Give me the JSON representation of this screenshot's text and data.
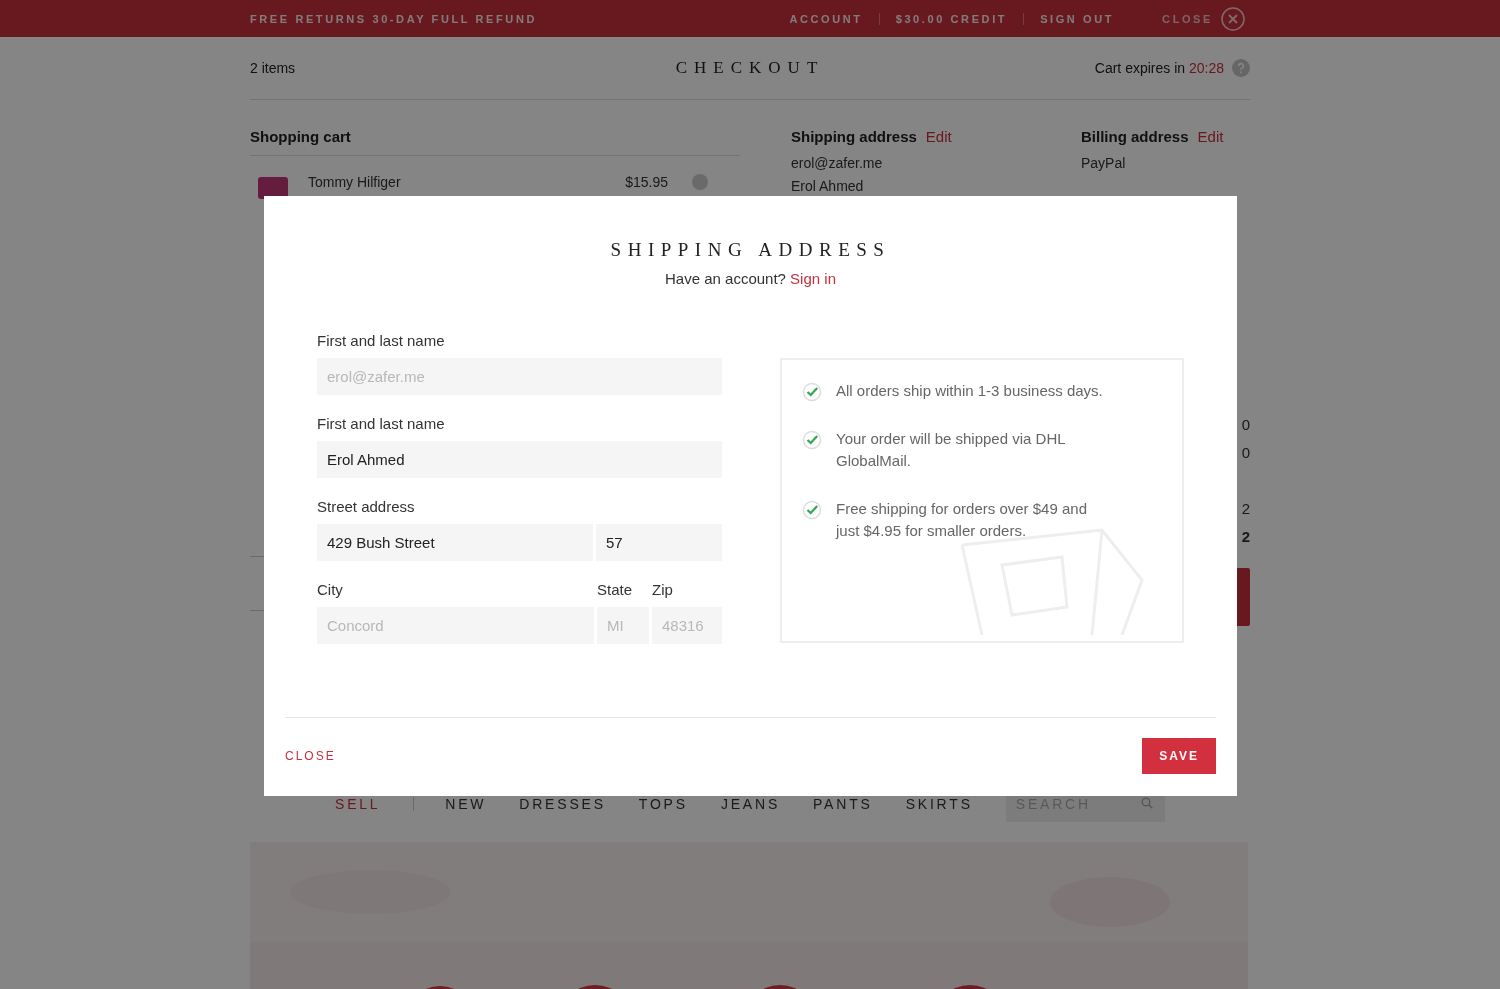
{
  "top_bar": {
    "promo": "FREE RETURNS 30-DAY FULL REFUND",
    "links": [
      "ACCOUNT",
      "$30.00 CREDIT",
      "SIGN OUT"
    ],
    "close": "CLOSE"
  },
  "header": {
    "item_count": "2 items",
    "title": "CHECKOUT",
    "expires_label": "Cart expires in",
    "expires_time": "20:28"
  },
  "cart": {
    "heading": "Shopping cart",
    "items": [
      {
        "name": "Tommy Hilfiger",
        "price": "$15.95"
      }
    ]
  },
  "addresses": [
    {
      "heading": "Shipping address",
      "edit": "Edit",
      "lines": [
        "erol@zafer.me",
        "Erol Ahmed"
      ]
    },
    {
      "heading": "Billing address",
      "edit": "Edit",
      "lines": [
        "PayPal"
      ]
    }
  ],
  "summary": [
    {
      "kind": "line",
      "value": "0"
    },
    {
      "kind": "line",
      "value": "0"
    },
    {
      "kind": "gap"
    },
    {
      "kind": "line",
      "value": "2"
    },
    {
      "kind": "total",
      "value": "2"
    }
  ],
  "nav": {
    "items": [
      {
        "label": "SELL",
        "kind": "highlight"
      },
      {
        "label": "NEW",
        "kind": "category"
      },
      {
        "label": "DRESSES",
        "kind": "category"
      },
      {
        "label": "TOPS",
        "kind": "category"
      },
      {
        "label": "JEANS",
        "kind": "category"
      },
      {
        "label": "PANTS",
        "kind": "category"
      },
      {
        "label": "SKIRTS",
        "kind": "category"
      }
    ],
    "search_placeholder": "SEARCH"
  },
  "modal": {
    "title": "SHIPPING ADDRESS",
    "prompt": "Have an account?",
    "sign_in": "Sign in",
    "field_rows": [
      {
        "fields": [
          {
            "label": "First and last name",
            "placeholder": "erol@zafer.me"
          }
        ]
      },
      {
        "fields": [
          {
            "label": "First and last name",
            "value": "Erol Ahmed"
          }
        ]
      },
      {
        "fields": [
          {
            "label": "Street address",
            "value": "429 Bush Street"
          },
          {
            "value": "57"
          }
        ]
      },
      {
        "fields": [
          {
            "label": "City",
            "placeholder": "Concord"
          },
          {
            "label": "State",
            "placeholder": "MI"
          },
          {
            "label": "Zip",
            "placeholder": "48316"
          }
        ]
      }
    ],
    "notes": [
      "All orders ship within 1-3 business days.",
      "Your order will be shipped via DHL GlobalMail.",
      "Free shipping for orders over $49 and just $4.95 for smaller orders."
    ],
    "close": "CLOSE",
    "save": "SAVE"
  }
}
